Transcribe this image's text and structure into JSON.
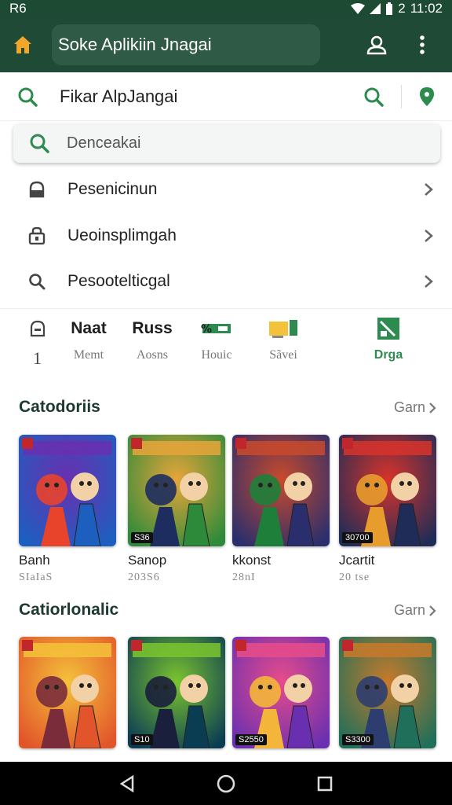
{
  "status_bar": {
    "left_text": "R6",
    "time": "11:02",
    "signal_label": "2"
  },
  "app_bar": {
    "search_text": "Soke Aplikiin Jnagai"
  },
  "search_row": {
    "label": "Fikar AlpJangai"
  },
  "search_field": {
    "placeholder": "Denceakai"
  },
  "menu": [
    {
      "label": "Pesenicinun",
      "icon": "lock-icon"
    },
    {
      "label": "Ueoinsplimgah",
      "icon": "lock-alt-icon"
    },
    {
      "label": "Pesootelticgal",
      "icon": "search-icon"
    }
  ],
  "quick": [
    {
      "top": "Naat",
      "bottom": "Memt",
      "icon": "lock-icon",
      "top_icon": "1"
    },
    {
      "top": "Russ",
      "bottom": "Aosns"
    },
    {
      "top": "",
      "bottom": "Houic",
      "icon": "ticket-icon"
    },
    {
      "top": "",
      "bottom": "Sãvei",
      "icon": "gift-icon"
    },
    {
      "top": "",
      "bottom": "Drga",
      "icon": "chart-icon",
      "active": true
    }
  ],
  "sections": [
    {
      "title": "Catodoriis",
      "more": "Garn",
      "games": [
        {
          "name": "Banh",
          "meta": "SIaIaS",
          "badge": "",
          "colors": [
            "#1d5fbf",
            "#6a2fb0",
            "#e8442b"
          ]
        },
        {
          "name": "Sanop",
          "meta": "203S6",
          "badge": "S36",
          "colors": [
            "#2c8a3a",
            "#e8a53a",
            "#1d2d5f"
          ]
        },
        {
          "name": "kkonst",
          "meta": "28nI",
          "badge": "",
          "colors": [
            "#2a2e6d",
            "#c94a2b",
            "#1e7f3a"
          ]
        },
        {
          "name": "Jcartit",
          "meta": "20 tse",
          "badge": "30700",
          "colors": [
            "#1f2c57",
            "#d8332a",
            "#e89c2c"
          ]
        }
      ]
    },
    {
      "title": "Catiorlonalic",
      "more": "Garn",
      "games": [
        {
          "name": "",
          "meta": "",
          "badge": "",
          "colors": [
            "#e2552a",
            "#f4c23a",
            "#7a2c3b"
          ]
        },
        {
          "name": "",
          "meta": "",
          "badge": "S10",
          "colors": [
            "#0b3d52",
            "#7bc42f",
            "#1a1f3b"
          ]
        },
        {
          "name": "",
          "meta": "",
          "badge": "S2550",
          "colors": [
            "#6a2fb0",
            "#e84c8a",
            "#f4b63a"
          ]
        },
        {
          "name": "",
          "meta": "",
          "badge": "S3300",
          "colors": [
            "#1f6f5a",
            "#c87a2a",
            "#2d3d6f"
          ]
        }
      ]
    }
  ],
  "colors": {
    "primary": "#1f4a35",
    "accent": "#2e8b50"
  }
}
